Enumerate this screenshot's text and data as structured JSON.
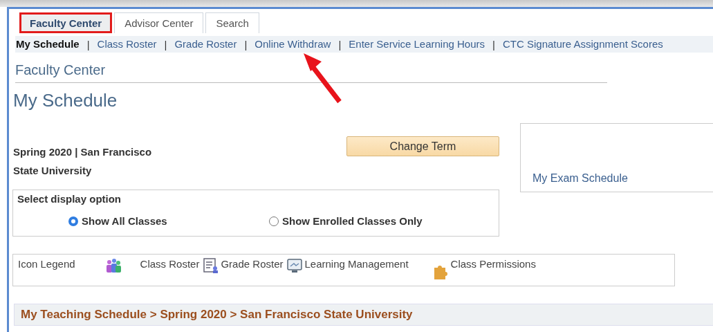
{
  "tabs": [
    {
      "label": "Faculty Center",
      "selected": true,
      "highlighted": true
    },
    {
      "label": "Advisor Center",
      "selected": false,
      "highlighted": false
    },
    {
      "label": "Search",
      "selected": false,
      "highlighted": false
    }
  ],
  "nav": [
    {
      "label": "My Schedule",
      "selected": true,
      "pointed": false
    },
    {
      "label": "Class Roster",
      "selected": false,
      "pointed": false
    },
    {
      "label": "Grade Roster",
      "selected": false,
      "pointed": false
    },
    {
      "label": "Online Withdraw",
      "selected": false,
      "pointed": true
    },
    {
      "label": "Enter Service Learning Hours",
      "selected": false,
      "pointed": false
    },
    {
      "label": "CTC Signature Assignment Scores",
      "selected": false,
      "pointed": false
    }
  ],
  "nav_separator": "|",
  "section_title": "Faculty Center",
  "page_title": "My Schedule",
  "term": "Spring 2020 | San Francisco State University",
  "change_term_button": "Change Term",
  "exam_schedule_link": "My Exam Schedule",
  "display_option": {
    "label": "Select display option",
    "options": [
      {
        "label": "Show All Classes",
        "selected": true
      },
      {
        "label": "Show Enrolled Classes Only",
        "selected": false
      }
    ]
  },
  "icon_legend": {
    "label": "Icon Legend",
    "items": [
      {
        "kind": "class-roster",
        "label": "Class Roster"
      },
      {
        "kind": "grade-roster",
        "label": "Grade Roster"
      },
      {
        "kind": "learning",
        "label": "Learning Management"
      },
      {
        "kind": "permissions",
        "label": "Class Permissions"
      }
    ]
  },
  "breadcrumb": "My Teaching Schedule > Spring 2020 > San Francisco State University"
}
